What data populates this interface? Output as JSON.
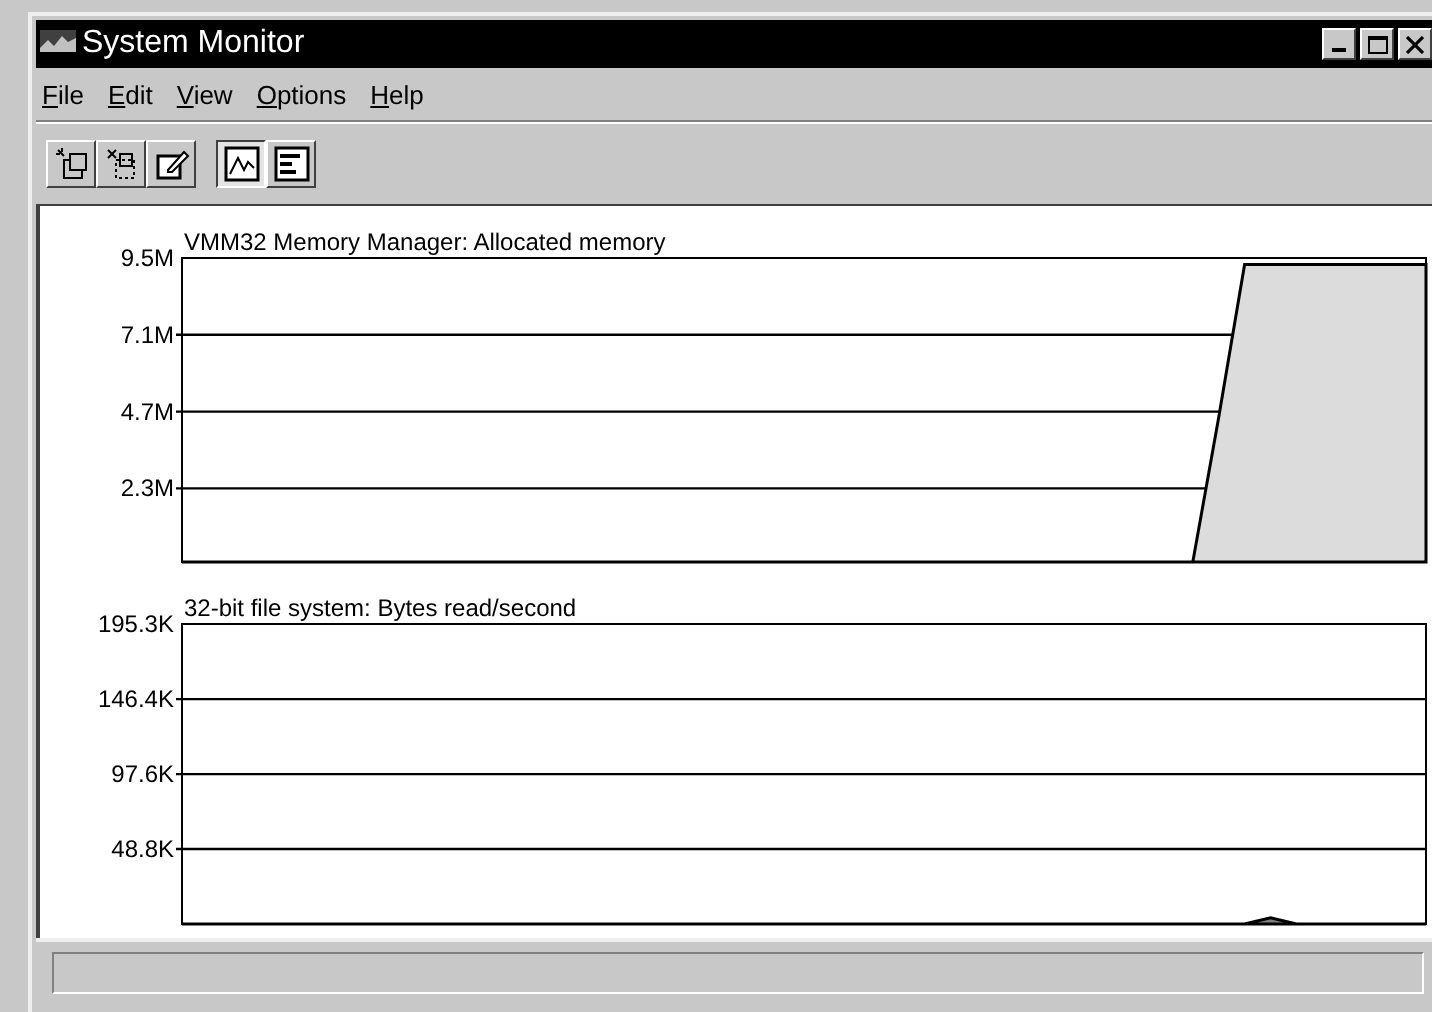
{
  "window": {
    "title": "System Monitor"
  },
  "menu": [
    {
      "label": "File"
    },
    {
      "label": "Edit"
    },
    {
      "label": "View"
    },
    {
      "label": "Options"
    },
    {
      "label": "Help"
    }
  ],
  "toolbar": [
    {
      "kind": "add",
      "selected": false
    },
    {
      "kind": "remove",
      "selected": false
    },
    {
      "kind": "edit",
      "selected": false
    },
    {
      "kind": "line",
      "selected": true
    },
    {
      "kind": "bar",
      "selected": false
    }
  ],
  "charts": [
    {
      "chart_data": {
        "type": "area",
        "title": "VMM32 Memory Manager: Allocated memory",
        "grid": true,
        "series": [
          {
            "color": "#dcdcdc",
            "values": [
              0,
              0,
              0,
              0,
              0,
              0,
              0,
              0,
              0,
              0,
              0,
              0,
              0,
              0,
              0,
              0,
              0,
              0,
              0,
              0,
              0,
              0,
              0,
              0,
              0,
              0,
              0,
              0,
              0,
              0,
              0,
              0,
              0,
              0,
              0,
              0,
              0,
              0,
              0,
              0,
              4.5,
              9.3,
              9.3,
              9.3,
              9.3,
              9.3,
              9.3,
              9.3,
              9.3
            ]
          }
        ],
        "ylim": [
          0,
          9.5
        ],
        "yticks": [
          {
            "value": 2.3,
            "label": "2.3M"
          },
          {
            "value": 4.7,
            "label": "4.7M"
          },
          {
            "value": 7.1,
            "label": "7.1M"
          },
          {
            "value": 9.5,
            "label": "9.5M"
          }
        ]
      }
    },
    {
      "chart_data": {
        "type": "area",
        "title": "32-bit file system: Bytes read/second",
        "grid": true,
        "series": [
          {
            "color": "#808080",
            "values": [
              0,
              0,
              0,
              0,
              0,
              0,
              0,
              0,
              0,
              0,
              0,
              0,
              0,
              0,
              0,
              0,
              0,
              0,
              0,
              0,
              0,
              0,
              0,
              0,
              0,
              0,
              0,
              0,
              0,
              0,
              0,
              0,
              0,
              0,
              0,
              0,
              0,
              0,
              0,
              0,
              0,
              0,
              4,
              0,
              0,
              0,
              0,
              0,
              0
            ]
          }
        ],
        "ylim": [
          0,
          195.3
        ],
        "yticks": [
          {
            "value": 48.8,
            "label": "48.8K"
          },
          {
            "value": 97.6,
            "label": "97.6K"
          },
          {
            "value": 146.4,
            "label": "146.4K"
          },
          {
            "value": 195.3,
            "label": "195.3K"
          }
        ]
      }
    }
  ]
}
